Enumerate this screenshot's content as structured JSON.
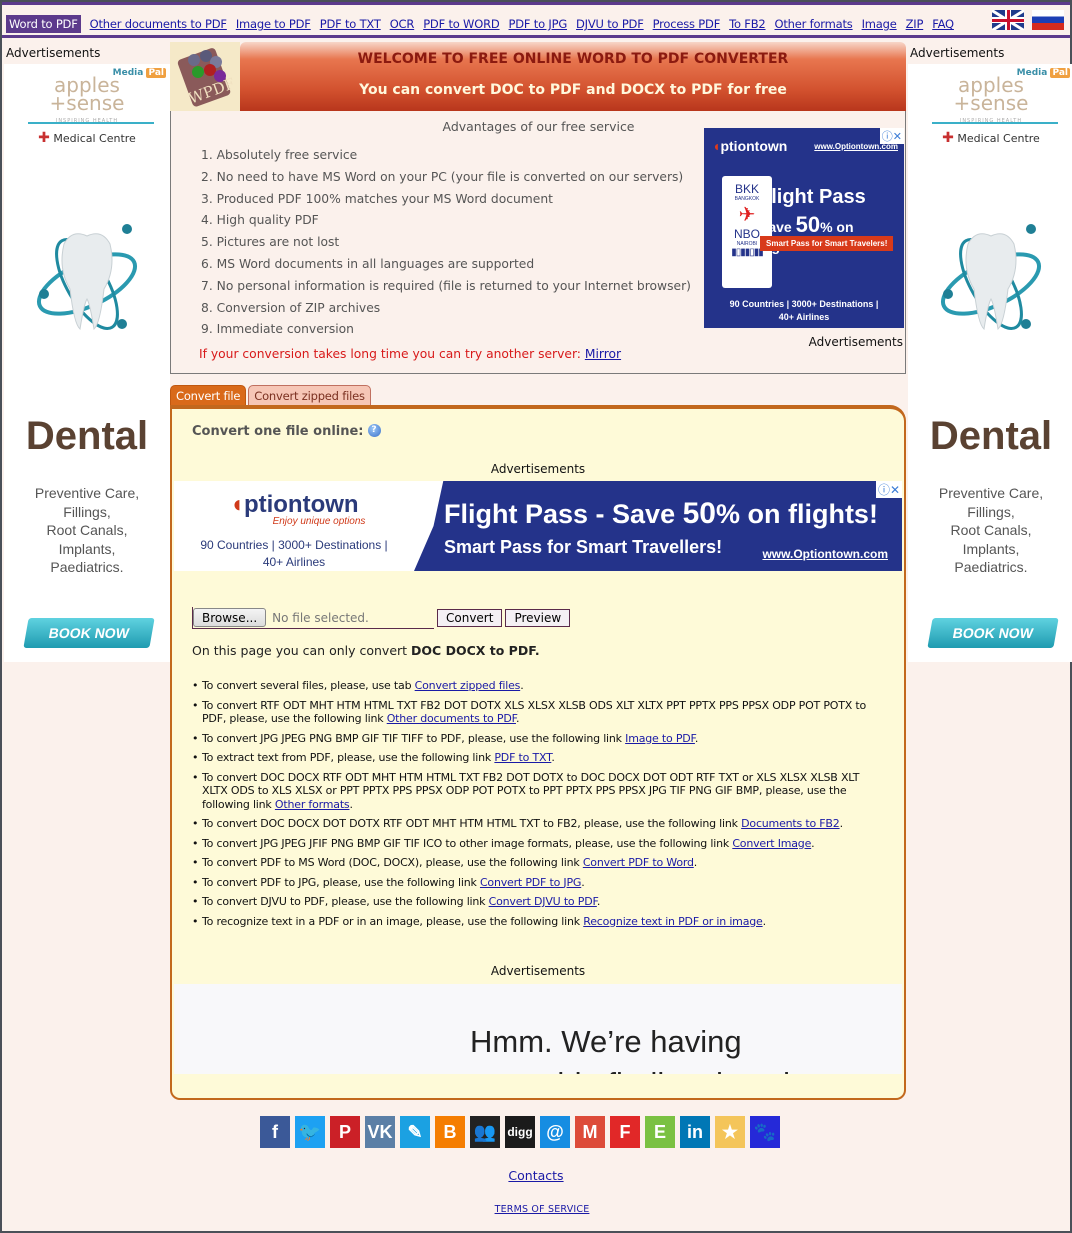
{
  "nav": {
    "items": [
      {
        "label": "Word to PDF",
        "active": true
      },
      {
        "label": "Other documents to PDF"
      },
      {
        "label": "Image to PDF"
      },
      {
        "label": "PDF to TXT"
      },
      {
        "label": "OCR"
      },
      {
        "label": "PDF to WORD"
      },
      {
        "label": "PDF to JPG"
      },
      {
        "label": "DJVU to PDF"
      },
      {
        "label": "Process PDF"
      },
      {
        "label": "To FB2"
      },
      {
        "label": "Other formats"
      },
      {
        "label": "Image"
      },
      {
        "label": "ZIP"
      },
      {
        "label": "FAQ"
      }
    ],
    "languages": [
      "English",
      "Russian"
    ]
  },
  "side_ads": {
    "label": "Advertisements",
    "mediapal": "Media",
    "mediapal_badge": "Pal",
    "brand_line1": "apples",
    "brand_line2": "+sense",
    "tagline": "INSPIRING HEALTH",
    "medical_centre": "Medical Centre",
    "headline": "Dental",
    "services": [
      "Preventive Care,",
      "Fillings,",
      "Root Canals,",
      "Implants,",
      "Paediatrics."
    ],
    "cta": "BOOK NOW"
  },
  "banner": {
    "logo_text": "WPDF",
    "title": "WELCOME TO FREE ONLINE WORD TO PDF CONVERTER",
    "subtitle": "You can convert DOC to PDF and DOCX to PDF for free"
  },
  "advantages": {
    "title": "Advantages of our free service",
    "items": [
      "1. Absolutely free service",
      "2. No need to have MS Word on your PC (your file is converted on our servers)",
      "3. Produced PDF 100% matches your MS Word document",
      "4. High quality PDF",
      "5. Pictures are not lost",
      "6. MS Word documents in all languages are supported",
      "7. No personal information is required (file is returned to your Internet browser)",
      "8. Conversion of ZIP archives",
      "9. Immediate conversion"
    ],
    "mirror_text": "If your conversion takes long time you can try another server: ",
    "mirror_link": "Mirror",
    "ad_label": "Advertisements"
  },
  "square_ad": {
    "brand": "ptiontown",
    "url": "www.Optiontown.com",
    "from_code": "BKK",
    "from_city": "BANGKOK",
    "to_code": "NBO",
    "to_city": "NAIROBI",
    "headline": "Flight Pass",
    "save_prefix": "Save ",
    "save_value": "50",
    "save_suffix": "% on flights!",
    "cta": "Smart Pass for Smart Travelers!",
    "footer_line1": "90 Countries | 3000+ Destinations |",
    "footer_line2": "40+ Airlines"
  },
  "tabs": [
    {
      "label": "Convert file",
      "active": true
    },
    {
      "label": "Convert zipped files",
      "active": false
    }
  ],
  "converter": {
    "title": "Convert one file online:",
    "ad_label": "Advertisements",
    "browse_label": "Browse...",
    "file_status": "No file selected.",
    "convert_label": "Convert",
    "preview_label": "Preview",
    "only_text": "On this page you can only convert ",
    "only_formats": "DOC DOCX to PDF.",
    "ad2_label": "Advertisements",
    "ad_error_line1": "Hmm. We’re having",
    "ad_error_line2": "trouble finding that site."
  },
  "banner_ad": {
    "brand": "ptiontown",
    "tagline": "Enjoy unique options",
    "stats_line1": "90 Countries | 3000+ Destinations |",
    "stats_line2": "40+ Airlines",
    "headline": "Flight Pass - Save ",
    "headline_value": "50",
    "headline_suffix": "% on flights!",
    "sub": "Smart Pass for Smart Travellers!",
    "url": "www.Optiontown.com"
  },
  "info": [
    {
      "text": "To convert several files, please, use tab ",
      "link": "Convert zipped files",
      "end": "."
    },
    {
      "text": "To convert RTF ODT MHT HTM HTML TXT FB2 DOT DOTX XLS XLSX XLSB ODS XLT XLTX PPT PPTX PPS PPSX ODP POT POTX to PDF, please, use the following link ",
      "link": "Other documents to PDF",
      "end": "."
    },
    {
      "text": "To convert JPG JPEG PNG BMP GIF TIF TIFF to PDF, please, use the following link ",
      "link": "Image to PDF",
      "end": "."
    },
    {
      "text": "To extract text from PDF, please, use the following link ",
      "link": "PDF to TXT",
      "end": "."
    },
    {
      "text": "To convert DOC DOCX RTF ODT MHT HTM HTML TXT FB2 DOT DOTX to DOC DOCX DOT ODT RTF TXT or XLS XLSX XLSB XLT XLTX ODS to XLS XLSX or PPT PPTX PPS PPSX ODP POT POTX to PPT PPTX PPS PPSX JPG TIF PNG GIF BMP, please, use the following link ",
      "link": "Other formats",
      "end": "."
    },
    {
      "text": "To convert DOC DOCX DOT DOTX RTF ODT MHT HTM HTML TXT to FB2, please, use the following link ",
      "link": "Documents to FB2",
      "end": "."
    },
    {
      "text": "To convert JPG JPEG JFIF PNG BMP GIF TIF ICO to other image formats, please, use the following link ",
      "link": "Convert Image",
      "end": "."
    },
    {
      "text": "To convert PDF to MS Word (DOC, DOCX), please, use the following link ",
      "link": "Convert PDF to Word",
      "end": "."
    },
    {
      "text": "To convert PDF to JPG, please, use the following link ",
      "link": "Convert PDF to JPG",
      "end": "."
    },
    {
      "text": "To convert DJVU to PDF, please, use the following link ",
      "link": "Convert DJVU to PDF",
      "end": "."
    },
    {
      "text": "To recognize text in a PDF or in an image, please, use the following link ",
      "link": "Recognize text in PDF or in image",
      "end": "."
    }
  ],
  "social": [
    {
      "name": "facebook",
      "glyph": "f",
      "color": "#3b5998"
    },
    {
      "name": "twitter",
      "glyph": "🐦",
      "color": "#1da1f2"
    },
    {
      "name": "pinterest",
      "glyph": "P",
      "color": "#cb2027"
    },
    {
      "name": "vk",
      "glyph": "VK",
      "color": "#5b7fa6"
    },
    {
      "name": "livejournal",
      "glyph": "✎",
      "color": "#1ba1e2"
    },
    {
      "name": "blogger",
      "glyph": "B",
      "color": "#f57d00"
    },
    {
      "name": "myspace",
      "glyph": "👥",
      "color": "#222222"
    },
    {
      "name": "digg",
      "glyph": "digg",
      "color": "#1b1b1b"
    },
    {
      "name": "mail",
      "glyph": "@",
      "color": "#168de2"
    },
    {
      "name": "gmail",
      "glyph": "M",
      "color": "#dd4b39"
    },
    {
      "name": "flipboard",
      "glyph": "F",
      "color": "#e12828"
    },
    {
      "name": "evernote",
      "glyph": "E",
      "color": "#7ac142"
    },
    {
      "name": "linkedin",
      "glyph": "in",
      "color": "#0077b5"
    },
    {
      "name": "bookmark",
      "glyph": "★",
      "color": "#f4c55a"
    },
    {
      "name": "baidu",
      "glyph": "🐾",
      "color": "#2529d8"
    }
  ],
  "footer": {
    "contacts": "Contacts",
    "terms": "TERMS OF SERVICE"
  }
}
